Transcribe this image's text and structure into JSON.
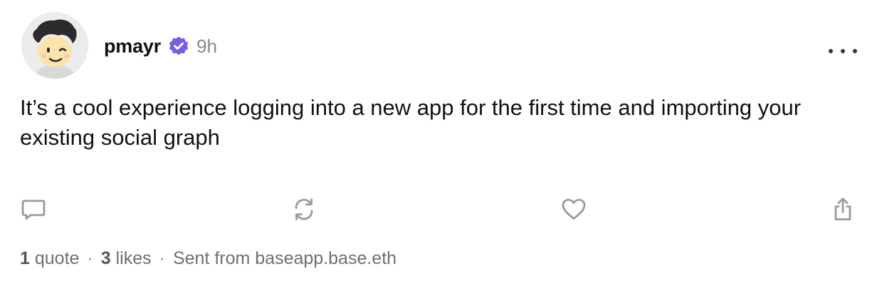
{
  "post": {
    "author": {
      "username": "pmayr",
      "verified": true,
      "time_ago": "9h"
    },
    "text": "It’s a cool experience logging into a new app for the first time and importing your existing social graph",
    "stats": {
      "quote_count": "1",
      "quote_label": "quote",
      "like_count": "3",
      "like_label": "likes",
      "separator": "·",
      "source": "Sent from baseapp.base.eth"
    }
  },
  "icons": {
    "reply": "speech-bubble-icon",
    "repost": "repost-arrows-icon",
    "like": "heart-icon",
    "share": "share-upload-icon",
    "more": "ellipsis-icon",
    "verified": "verified-badge-icon"
  },
  "colors": {
    "accent_verified": "#7c5ce6",
    "text_primary": "#111111",
    "text_secondary": "#8a8a8a",
    "icon_gray": "#9a9a9a"
  }
}
